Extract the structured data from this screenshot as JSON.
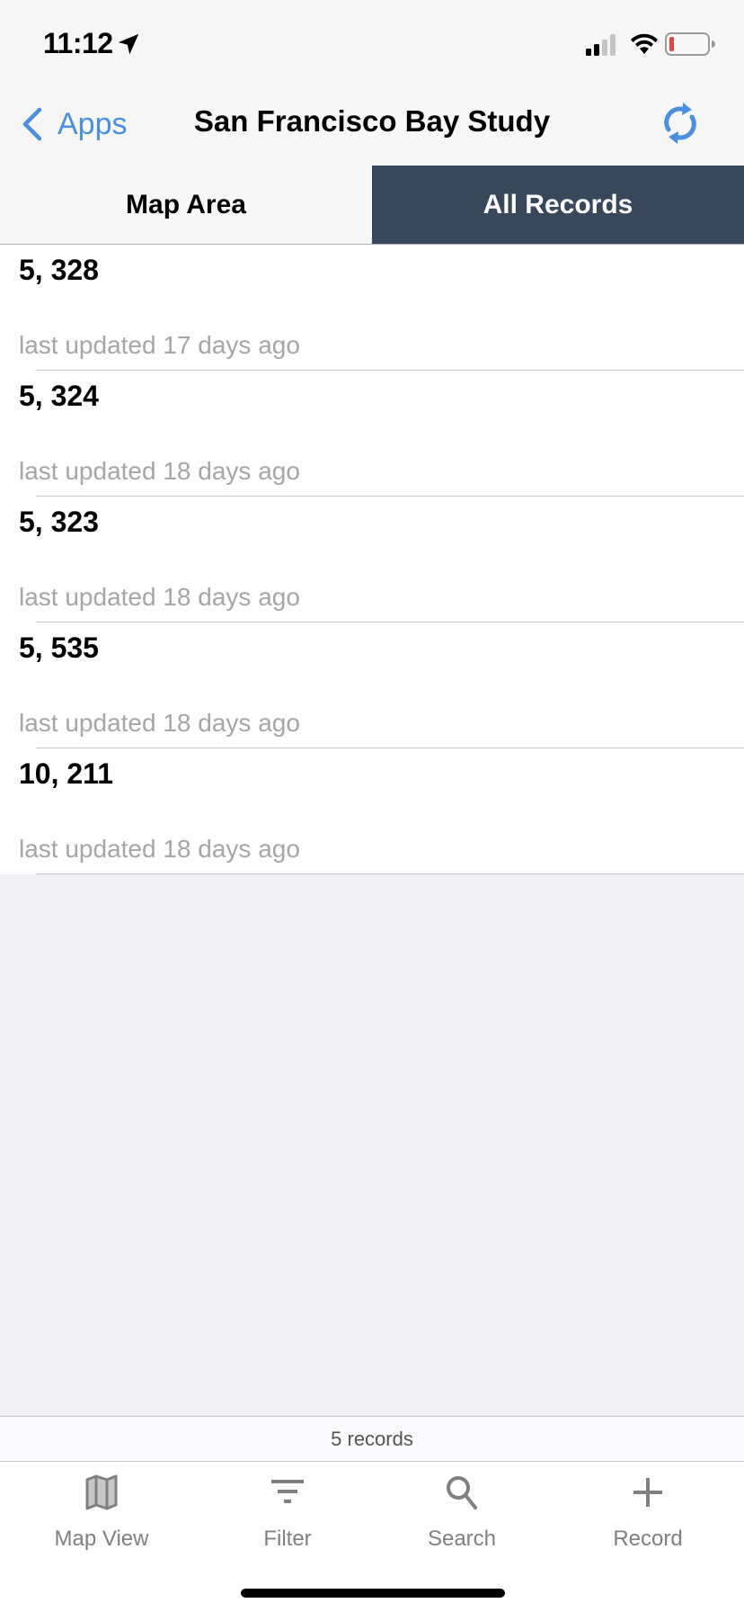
{
  "status_bar": {
    "time": "11:12",
    "icons": [
      "location-arrow-icon",
      "cellular-signal-icon",
      "wifi-icon",
      "battery-low-icon"
    ]
  },
  "nav": {
    "back_label": "Apps",
    "title": "San Francisco Bay Study",
    "sync_icon": "sync-icon"
  },
  "segments": [
    {
      "label": "Map Area",
      "active": false
    },
    {
      "label": "All Records",
      "active": true
    }
  ],
  "records": [
    {
      "title": "5, 328",
      "subtitle": "last updated 17 days ago"
    },
    {
      "title": "5, 324",
      "subtitle": "last updated 18 days ago"
    },
    {
      "title": "5, 323",
      "subtitle": "last updated 18 days ago"
    },
    {
      "title": "5, 535",
      "subtitle": "last updated 18 days ago"
    },
    {
      "title": "10, 211",
      "subtitle": "last updated 18 days ago"
    }
  ],
  "records_count": "5 records",
  "tab_bar": [
    {
      "label": "Map View",
      "icon": "map-icon"
    },
    {
      "label": "Filter",
      "icon": "filter-icon"
    },
    {
      "label": "Search",
      "icon": "search-icon"
    },
    {
      "label": "Record",
      "icon": "plus-icon"
    }
  ],
  "colors": {
    "accent": "#4a90e2",
    "active_segment": "#37475c",
    "battery_low": "#e5453a"
  }
}
